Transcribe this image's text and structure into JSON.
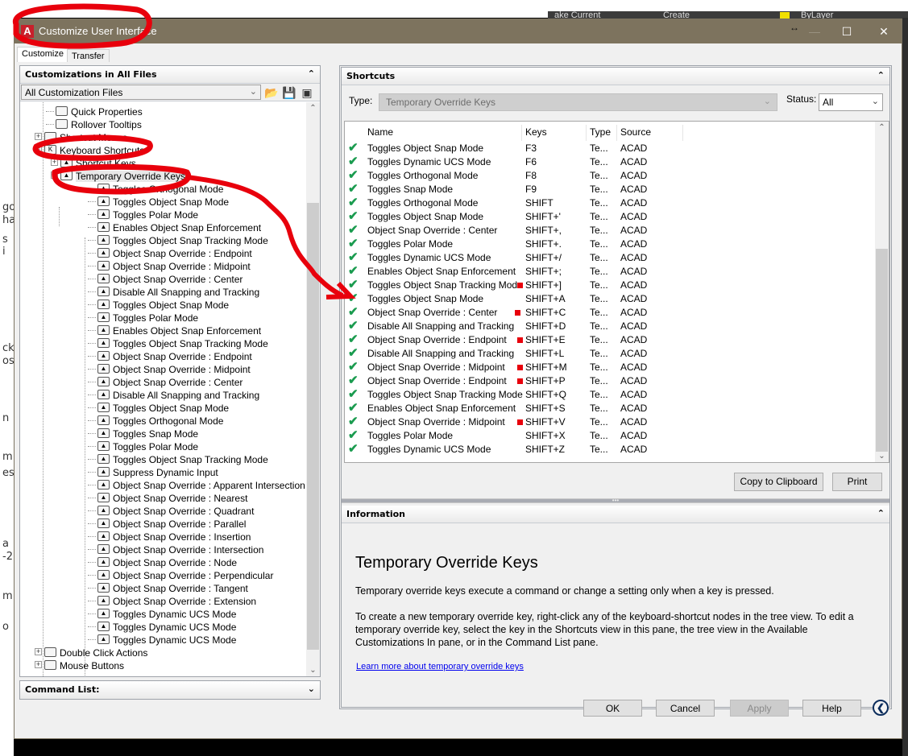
{
  "background_app": {
    "ribbon_items": [
      "ake Current",
      "Create",
      "ByLayer"
    ],
    "left_fragments": [
      "go",
      "ha",
      "s i",
      "ck",
      "os",
      "n",
      "m",
      "es",
      "a",
      "-2",
      "m",
      "o"
    ]
  },
  "dialog": {
    "title": "Customize User Interface",
    "window_controls": {
      "minimize": "—",
      "maximize": "☐",
      "close": "✕",
      "resize": "↔"
    },
    "tabs": [
      {
        "label": "Customize",
        "active": true
      },
      {
        "label": "Transfer",
        "active": false
      }
    ]
  },
  "left_panel": {
    "header": "Customizations in All Files",
    "collapse_icon": "double-chevron-up",
    "file_select": {
      "value": "All Customization Files"
    },
    "toolbar_icons": [
      "open-file-icon",
      "save-icon",
      "display-filter-icon"
    ],
    "tree": [
      {
        "label": "Quick Properties",
        "level": 1,
        "icon": "properties-icon"
      },
      {
        "label": "Rollover Tooltips",
        "level": 1,
        "icon": "tooltip-icon"
      },
      {
        "label": "Shortcut Menus",
        "level": 1,
        "icon": "menu-icon",
        "expander": "+"
      },
      {
        "label": "Keyboard Shortcuts",
        "level": 1,
        "icon": "keyboard-icon",
        "expander": "−"
      },
      {
        "label": "Shortcut Keys",
        "level": 2,
        "icon": "key-icon",
        "expander": "+"
      },
      {
        "label": "Temporary Override Keys",
        "level": 2,
        "icon": "key-icon",
        "expander": "−",
        "selected": true
      },
      {
        "label": "Toggles Orthogonal Mode",
        "level": 3
      },
      {
        "label": "Toggles Object Snap Mode",
        "level": 3
      },
      {
        "label": "Toggles Polar Mode",
        "level": 3
      },
      {
        "label": "Enables Object Snap Enforcement",
        "level": 3
      },
      {
        "label": "Toggles Object Snap Tracking Mode",
        "level": 3
      },
      {
        "label": "Object Snap Override : Endpoint",
        "level": 3
      },
      {
        "label": "Object Snap Override : Midpoint",
        "level": 3
      },
      {
        "label": "Object Snap Override : Center",
        "level": 3
      },
      {
        "label": "Disable All Snapping and Tracking",
        "level": 3
      },
      {
        "label": "Toggles Object Snap Mode",
        "level": 3
      },
      {
        "label": "Toggles Polar Mode",
        "level": 3
      },
      {
        "label": "Enables Object Snap Enforcement",
        "level": 3
      },
      {
        "label": "Toggles Object Snap Tracking Mode",
        "level": 3
      },
      {
        "label": "Object Snap Override : Endpoint",
        "level": 3
      },
      {
        "label": "Object Snap Override : Midpoint",
        "level": 3
      },
      {
        "label": "Object Snap Override : Center",
        "level": 3
      },
      {
        "label": "Disable All Snapping and Tracking",
        "level": 3
      },
      {
        "label": "Toggles Object Snap Mode",
        "level": 3
      },
      {
        "label": "Toggles Orthogonal Mode",
        "level": 3
      },
      {
        "label": "Toggles Snap Mode",
        "level": 3
      },
      {
        "label": "Toggles Polar Mode",
        "level": 3
      },
      {
        "label": "Toggles Object Snap Tracking Mode",
        "level": 3
      },
      {
        "label": "Suppress Dynamic Input",
        "level": 3
      },
      {
        "label": "Object Snap Override : Apparent Intersection",
        "level": 3
      },
      {
        "label": "Object Snap Override : Nearest",
        "level": 3
      },
      {
        "label": "Object Snap Override : Quadrant",
        "level": 3
      },
      {
        "label": "Object Snap Override : Parallel",
        "level": 3
      },
      {
        "label": "Object Snap Override : Insertion",
        "level": 3
      },
      {
        "label": "Object Snap Override : Intersection",
        "level": 3
      },
      {
        "label": "Object Snap Override : Node",
        "level": 3
      },
      {
        "label": "Object Snap Override : Perpendicular",
        "level": 3
      },
      {
        "label": "Object Snap Override : Tangent",
        "level": 3
      },
      {
        "label": "Object Snap Override : Extension",
        "level": 3
      },
      {
        "label": "Toggles Dynamic UCS Mode",
        "level": 3
      },
      {
        "label": "Toggles Dynamic UCS Mode",
        "level": 3
      },
      {
        "label": "Toggles Dynamic UCS Mode",
        "level": 3
      },
      {
        "label": "Double Click Actions",
        "level": 1,
        "icon": "mouse-icon",
        "expander": "+"
      },
      {
        "label": "Mouse Buttons",
        "level": 1,
        "icon": "mouse-icon",
        "expander": "+"
      }
    ]
  },
  "command_list": {
    "header": "Command List:",
    "collapse_icon": "double-chevron-down"
  },
  "shortcuts_panel": {
    "header": "Shortcuts",
    "type_label": "Type:",
    "type_value": "Temporary Override Keys",
    "status_label": "Status:",
    "status_value": "All",
    "columns": [
      "Name",
      "Keys",
      "Type",
      "Source"
    ],
    "rows": [
      {
        "name": "Toggles Object Snap Mode",
        "keys": "F3",
        "type": "Te...",
        "source": "ACAD",
        "marked": false
      },
      {
        "name": "Toggles Dynamic UCS Mode",
        "keys": "F6",
        "type": "Te...",
        "source": "ACAD",
        "marked": false
      },
      {
        "name": "Toggles Orthogonal Mode",
        "keys": "F8",
        "type": "Te...",
        "source": "ACAD",
        "marked": false
      },
      {
        "name": "Toggles Snap Mode",
        "keys": "F9",
        "type": "Te...",
        "source": "ACAD",
        "marked": false
      },
      {
        "name": "Toggles Orthogonal Mode",
        "keys": "SHIFT",
        "type": "Te...",
        "source": "ACAD",
        "marked": false
      },
      {
        "name": "Toggles Object Snap Mode",
        "keys": "SHIFT+'",
        "type": "Te...",
        "source": "ACAD",
        "marked": false
      },
      {
        "name": "Object Snap Override : Center",
        "keys": "SHIFT+,",
        "type": "Te...",
        "source": "ACAD",
        "marked": false
      },
      {
        "name": "Toggles Polar Mode",
        "keys": "SHIFT+.",
        "type": "Te...",
        "source": "ACAD",
        "marked": false
      },
      {
        "name": "Toggles Dynamic UCS Mode",
        "keys": "SHIFT+/",
        "type": "Te...",
        "source": "ACAD",
        "marked": false
      },
      {
        "name": "Enables Object Snap Enforcement",
        "keys": "SHIFT+;",
        "type": "Te...",
        "source": "ACAD",
        "marked": false
      },
      {
        "name": "Toggles Object Snap Tracking Mode",
        "keys": "SHIFT+]",
        "type": "Te...",
        "source": "ACAD",
        "marked": true
      },
      {
        "name": "Toggles Object Snap Mode",
        "keys": "SHIFT+A",
        "type": "Te...",
        "source": "ACAD",
        "marked": false
      },
      {
        "name": "Object Snap Override : Center",
        "keys": "SHIFT+C",
        "type": "Te...",
        "source": "ACAD",
        "marked": true
      },
      {
        "name": "Disable All Snapping and Tracking",
        "keys": "SHIFT+D",
        "type": "Te...",
        "source": "ACAD",
        "marked": false
      },
      {
        "name": "Object Snap Override : Endpoint",
        "keys": "SHIFT+E",
        "type": "Te...",
        "source": "ACAD",
        "marked": true
      },
      {
        "name": "Disable All Snapping and Tracking",
        "keys": "SHIFT+L",
        "type": "Te...",
        "source": "ACAD",
        "marked": false
      },
      {
        "name": "Object Snap Override : Midpoint",
        "keys": "SHIFT+M",
        "type": "Te...",
        "source": "ACAD",
        "marked": true
      },
      {
        "name": "Object Snap Override : Endpoint",
        "keys": "SHIFT+P",
        "type": "Te...",
        "source": "ACAD",
        "marked": true
      },
      {
        "name": "Toggles Object Snap Tracking Mode",
        "keys": "SHIFT+Q",
        "type": "Te...",
        "source": "ACAD",
        "marked": false
      },
      {
        "name": "Enables Object Snap Enforcement",
        "keys": "SHIFT+S",
        "type": "Te...",
        "source": "ACAD",
        "marked": false
      },
      {
        "name": "Object Snap Override : Midpoint",
        "keys": "SHIFT+V",
        "type": "Te...",
        "source": "ACAD",
        "marked": true
      },
      {
        "name": "Toggles Polar Mode",
        "keys": "SHIFT+X",
        "type": "Te...",
        "source": "ACAD",
        "marked": false
      },
      {
        "name": "Toggles Dynamic UCS Mode",
        "keys": "SHIFT+Z",
        "type": "Te...",
        "source": "ACAD",
        "marked": false
      }
    ],
    "copy_button": "Copy to Clipboard",
    "print_button": "Print"
  },
  "information_panel": {
    "header": "Information",
    "title": "Temporary Override Keys",
    "paragraph1": "Temporary override keys execute a command or change a setting only when a key is pressed.",
    "paragraph2": "To create a new temporary override key, right-click any of the keyboard-shortcut nodes in the tree view. To edit a temporary override key, select the key in the Shortcuts view in this pane, the tree view in the Available Customizations In pane, or in the Command List pane.",
    "link": "Learn more about temporary override keys"
  },
  "footer_buttons": {
    "ok": "OK",
    "cancel": "Cancel",
    "apply": "Apply",
    "apply_disabled": true,
    "help": "Help"
  },
  "colors": {
    "titlebar": "#7d735e",
    "annotation_red": "#e8000c",
    "check_green": "#1a9b4f"
  }
}
